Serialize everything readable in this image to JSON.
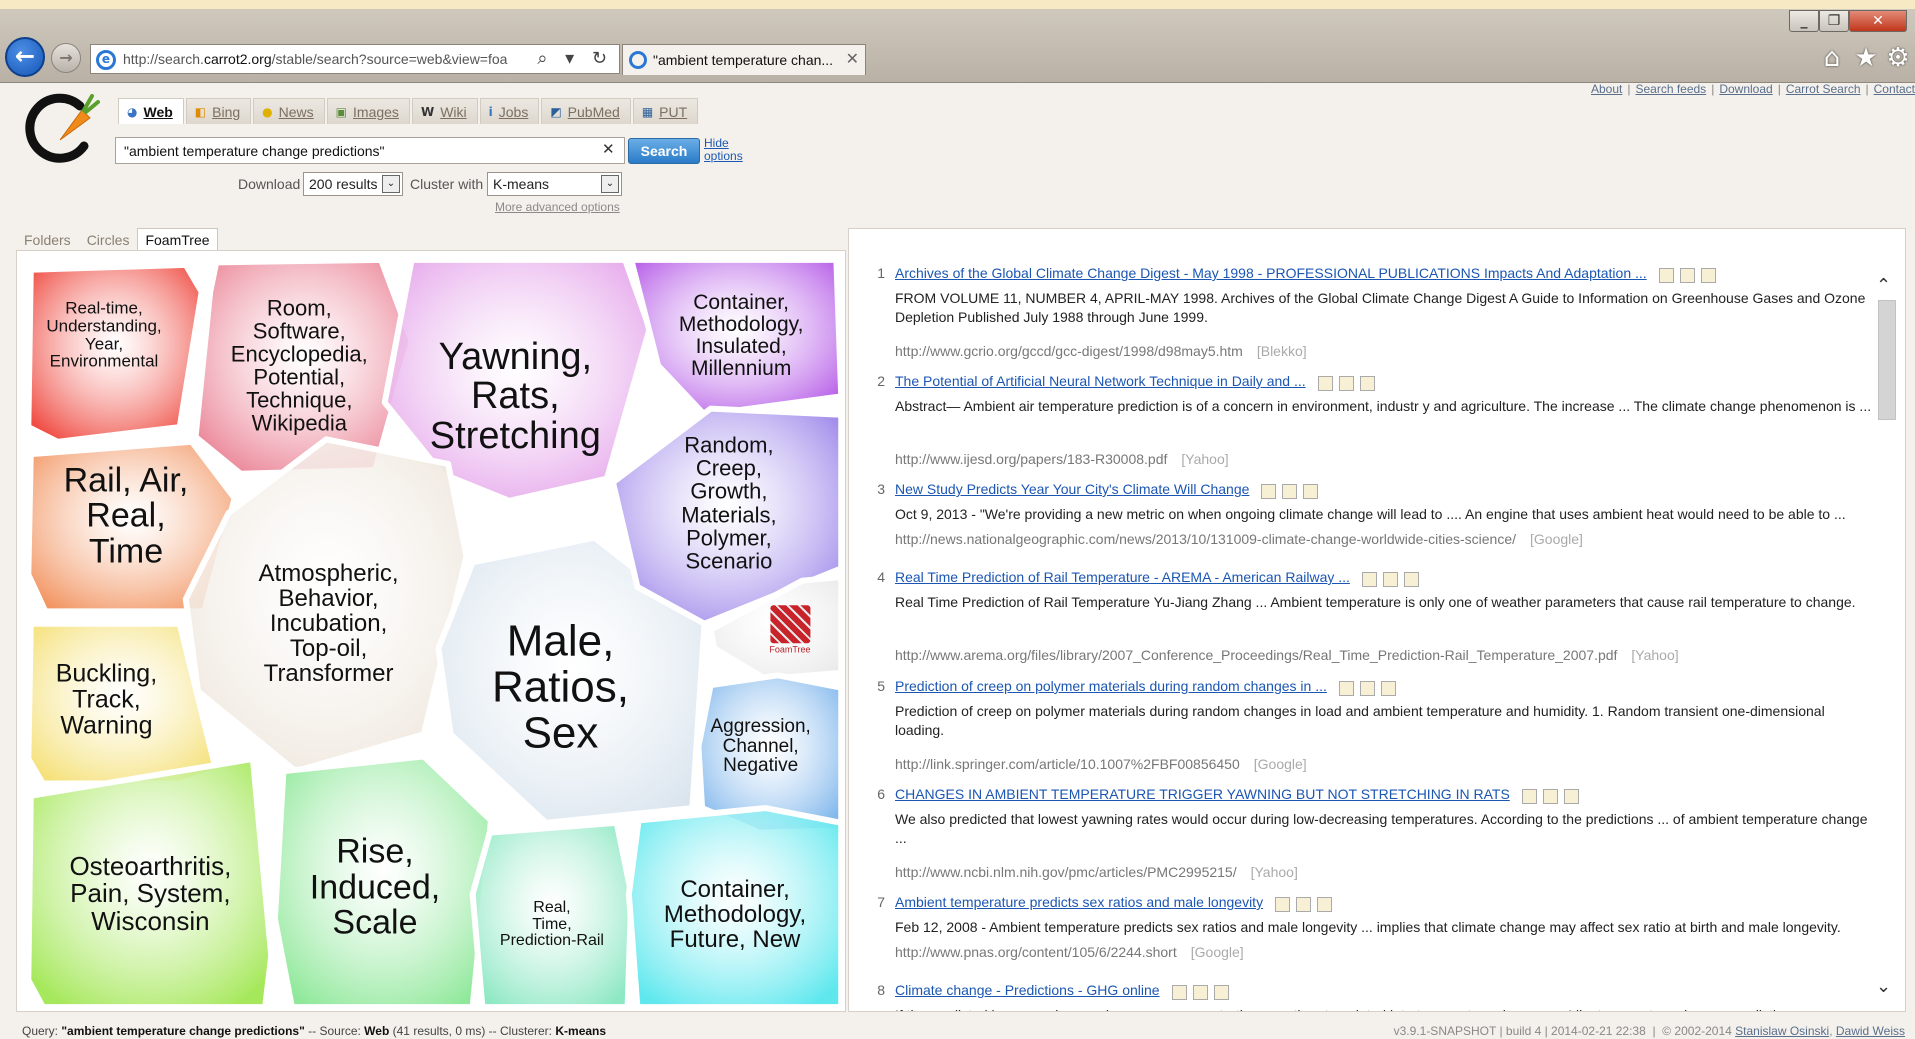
{
  "browser": {
    "url_prefix": "http://search.",
    "url_domain": "carrot2.org",
    "url_rest": "/stable/search?source=web&view=foa",
    "tab_title": "\"ambient temperature chan...",
    "back": "←",
    "forward": "→",
    "tab_close": "✕",
    "toolbar_glyphs": "⌕ ▾ ↻",
    "home": "⌂",
    "star": "★",
    "gear": "⚙",
    "min": "_",
    "max": "❐",
    "close": "✕"
  },
  "header": {
    "links": [
      "About",
      "Search feeds",
      "Download",
      "Carrot Search",
      "Contact"
    ],
    "source_tabs": [
      {
        "label": "Web",
        "icon": "◕",
        "color": "#3a74c4"
      },
      {
        "label": "Bing",
        "icon": "◧",
        "color": "#e08a00"
      },
      {
        "label": "News",
        "icon": "●",
        "color": "#e0b000"
      },
      {
        "label": "Images",
        "icon": "▣",
        "color": "#5b8c3a"
      },
      {
        "label": "Wiki",
        "icon": "W",
        "color": "#333333"
      },
      {
        "label": "Jobs",
        "icon": "i",
        "color": "#3a74c4"
      },
      {
        "label": "PubMed",
        "icon": "◩",
        "color": "#2a5f9c"
      },
      {
        "label": "PUT",
        "icon": "▦",
        "color": "#2a5f9c"
      }
    ],
    "query": "\"ambient temperature change predictions\"",
    "clear": "✕",
    "search_label": "Search",
    "hide_options": "Hide options",
    "download_label": "Download",
    "download_value": "200 results",
    "cluster_label": "Cluster with",
    "cluster_value": "K-means",
    "dropdown_glyph": "⌄",
    "more_options": "More advanced options"
  },
  "views": [
    "Folders",
    "Circles",
    "FoamTree"
  ],
  "foamtree": {
    "watermark": "FoamTree",
    "cells": [
      {
        "label": "Real-time,\nUnderstanding,\nYear,\nEnvironmental",
        "color": "#ef4b42"
      },
      {
        "label": "Room,\nSoftware,\nEncyclopedia,\nPotential,\nTechnique,\nWikipedia",
        "color": "#ea8093"
      },
      {
        "label": "Yawning,\nRats,\nStretching",
        "color": "#e4a2ea"
      },
      {
        "label": "Container,\nMethodology,\nInsulated,\nMillennium",
        "color": "#b75fe8"
      },
      {
        "label": "Rail, Air,\nReal,\nTime",
        "color": "#f29562"
      },
      {
        "label": "Atmospheric,\nBehavior,\nIncubation,\nTop-oil,\nTransformer",
        "color": "#eee6dc"
      },
      {
        "label": "Male,\nRatios,\nSex",
        "color": "#d9e4ee"
      },
      {
        "label": "Random,\nCreep,\nGrowth,\nMaterials,\nPolymer,\nScenario",
        "color": "#9c86ea"
      },
      {
        "label": "",
        "color": "#eaeaea"
      },
      {
        "label": "Buckling,\nTrack,\nWarning",
        "color": "#f5e17a"
      },
      {
        "label": "Aggression,\nChannel,\nNegative",
        "color": "#7fb6ec"
      },
      {
        "label": "Osteoarthritis,\nPain, System,\nWisconsin",
        "color": "#a6e85c"
      },
      {
        "label": "Rise,\nInduced,\nScale",
        "color": "#8fe89a"
      },
      {
        "label": "Real,\nTime,\nPrediction-Rail",
        "color": "#8ee8c4"
      },
      {
        "label": "Container,\nMethodology,\nFuture, New",
        "color": "#5ee8ee"
      }
    ]
  },
  "results": [
    {
      "num": "1",
      "title": "Archives of the Global Climate Change Digest - May 1998 - PROFESSIONAL PUBLICATIONS Impacts And Adaptation ...",
      "snippet": "FROM VOLUME 11, NUMBER 4, APRIL-MAY 1998. Archives of the Global Climate Change Digest A Guide to Information on Greenhouse Gases and Ozone Depletion Published July 1988 through June 1999.",
      "url": "http://www.gcrio.org/gccd/gcc-digest/1998/d98may5.htm",
      "source": "[Blekko]"
    },
    {
      "num": "2",
      "title": "The Potential of Artificial Neural Network Technique in Daily and ...",
      "snippet": "Abstract— Ambient air temperature prediction is of a concern in environment, industr y and agriculture. The increase ... The climate change phenomenon is ...",
      "url": "http://www.ijesd.org/papers/183-R30008.pdf",
      "source": "[Yahoo]"
    },
    {
      "num": "3",
      "title": "New Study Predicts Year Your City's Climate Will Change",
      "snippet": "Oct 9, 2013 - \"We're providing a new metric on when ongoing climate change will lead to .... An engine that uses ambient heat would need to be able to ...",
      "url": "http://news.nationalgeographic.com/news/2013/10/131009-climate-change-worldwide-cities-science/",
      "source": "[Google]"
    },
    {
      "num": "4",
      "title": "Real Time Prediction of Rail Temperature - AREMA - American Railway ...",
      "snippet": "Real Time Prediction of Rail Temperature Yu-Jiang Zhang ... Ambient temperature is only one of weather parameters that cause rail temperature to change.",
      "url": "http://www.arema.org/files/library/2007_Conference_Proceedings/Real_Time_Prediction-Rail_Temperature_2007.pdf",
      "source": "[Yahoo]"
    },
    {
      "num": "5",
      "title": "Prediction of creep on polymer materials during random changes in ...",
      "snippet": "Prediction of creep on polymer materials during random changes in load and ambient temperature and humidity. 1. Random transient one-dimensional loading.",
      "url": "http://link.springer.com/article/10.1007%2FBF00856450",
      "source": "[Google]"
    },
    {
      "num": "6",
      "title": "CHANGES IN AMBIENT TEMPERATURE TRIGGER YAWNING BUT NOT STRETCHING IN RATS",
      "snippet": "We also predicted that lowest yawning rates would occur during low-decreasing temperatures. According to the predictions ... of ambient temperature change ...",
      "url": "http://www.ncbi.nlm.nih.gov/pmc/articles/PMC2995215/",
      "source": "[Yahoo]"
    },
    {
      "num": "7",
      "title": "Ambient temperature predicts sex ratios and male longevity",
      "snippet": "Feb 12, 2008 - Ambient temperature predicts sex ratios and male longevity ... implies that climate change may affect sex ratio at birth and male longevity.",
      "url": "http://www.pnas.org/content/105/6/2244.short",
      "source": "[Google]"
    },
    {
      "num": "8",
      "title": "Climate change - Predictions - GHG online",
      "snippet": "If the predicted increases in greenhouse gas concentrations are then translated into temperature changes ... Like temperature change, predictions vary",
      "url": "",
      "source": ""
    }
  ],
  "scroll": {
    "up": "⌃",
    "down": "⌄"
  },
  "status": {
    "query_label": "Query:",
    "query": "\"ambient temperature change predictions\"",
    "source_label": "-- Source:",
    "source": "Web",
    "source_info": "(41 results, 0 ms) -- Clusterer:",
    "clusterer": "K-means",
    "version": "v3.9.1-SNAPSHOT | build 4 | 2014-02-21 22:38",
    "copyright": "© 2002-2014",
    "author1": "Stanislaw Osinski",
    "author2": "Dawid Weiss"
  }
}
